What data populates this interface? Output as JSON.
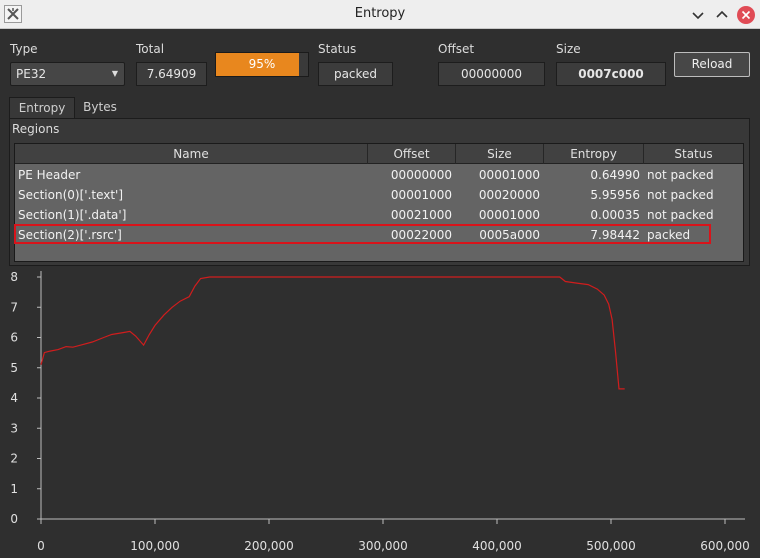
{
  "window": {
    "title": "Entropy"
  },
  "info": {
    "type_label": "Type",
    "type_value": "PE32",
    "total_label": "Total",
    "total_value": "7.64909",
    "progress_text": "95%",
    "progress_fraction": 0.95,
    "status_label": "Status",
    "status_value": "packed",
    "offset_label": "Offset",
    "offset_value": "00000000",
    "size_label": "Size",
    "size_value": "0007c000",
    "reload_label": "Reload"
  },
  "tabs": [
    "Entropy",
    "Bytes"
  ],
  "regions": {
    "label": "Regions",
    "columns": [
      "Name",
      "Offset",
      "Size",
      "Entropy",
      "Status"
    ],
    "rows": [
      [
        "PE Header",
        "00000000",
        "00001000",
        "0.64990",
        "not packed"
      ],
      [
        "Section(0)['.text']",
        "00001000",
        "00020000",
        "5.95956",
        "not packed"
      ],
      [
        "Section(1)['.data']",
        "00021000",
        "00001000",
        "0.00035",
        "not packed"
      ],
      [
        "Section(2)['.rsrc']",
        "00022000",
        "0005a000",
        "7.98442",
        "packed"
      ]
    ],
    "highlighted_row": 3,
    "highlight_color": "#d9131a"
  },
  "chart_data": {
    "type": "line",
    "xlim": [
      0,
      600000
    ],
    "ylim": [
      0,
      8
    ],
    "xticks": [
      0,
      100000,
      200000,
      300000,
      400000,
      500000,
      600000
    ],
    "xtick_labels": [
      "0",
      "100,000",
      "200,000",
      "300,000",
      "400,000",
      "500,000",
      "600,000"
    ],
    "yticks": [
      0,
      1,
      2,
      3,
      4,
      5,
      6,
      7,
      8
    ],
    "ytick_labels": [
      "0",
      "1",
      "2",
      "3",
      "4",
      "5",
      "6",
      "7",
      "8"
    ],
    "grid": false,
    "series": [
      {
        "color": "#d01d1d",
        "x": [
          0,
          3000,
          8000,
          15000,
          22000,
          28000,
          35000,
          45000,
          55000,
          62000,
          70000,
          78000,
          83000,
          90000,
          95000,
          100000,
          108000,
          115000,
          122000,
          130000,
          135000,
          140000,
          148000,
          160000,
          200000,
          300000,
          400000,
          455000,
          460000,
          470000,
          480000,
          488000,
          494000,
          498000,
          501000,
          504000,
          507000,
          512000
        ],
        "y": [
          5.1,
          5.5,
          5.55,
          5.6,
          5.7,
          5.68,
          5.75,
          5.85,
          6.0,
          6.1,
          6.15,
          6.2,
          6.05,
          5.75,
          6.1,
          6.4,
          6.75,
          7.0,
          7.2,
          7.35,
          7.7,
          7.95,
          8.0,
          8.0,
          8.0,
          8.0,
          8.0,
          8.0,
          7.85,
          7.8,
          7.75,
          7.6,
          7.4,
          7.1,
          6.6,
          5.5,
          4.3,
          4.3
        ]
      }
    ]
  }
}
